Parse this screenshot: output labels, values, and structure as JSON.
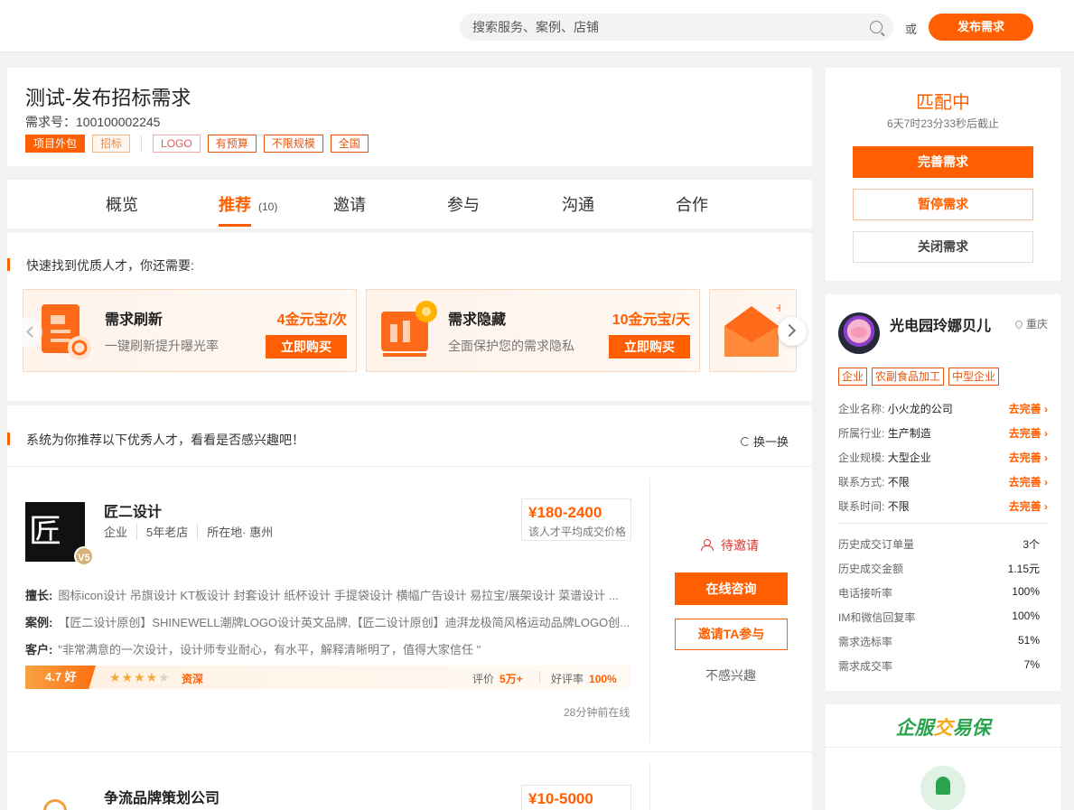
{
  "header": {
    "search_placeholder": "搜索服务、案例、店铺",
    "or_text": "或",
    "publish_label": "发布需求"
  },
  "requirement": {
    "title": "测试-发布招标需求",
    "number": "需求号：100100002245",
    "tags_primary": [
      "项目外包",
      "招标"
    ],
    "tags_secondary": [
      "LOGO",
      "有预算",
      "不限规模",
      "全国"
    ]
  },
  "tabs": [
    {
      "label": "概览"
    },
    {
      "label": "推荐",
      "count": "(10)"
    },
    {
      "label": "邀请"
    },
    {
      "label": "参与"
    },
    {
      "label": "沟通"
    },
    {
      "label": "合作"
    }
  ],
  "quick": {
    "title": "快速找到优质人才，你还需要:",
    "items": [
      {
        "name": "需求刷新",
        "desc": "一键刷新提升曝光率",
        "price": "4金元宝/次",
        "button": "立即购买"
      },
      {
        "name": "需求隐藏",
        "desc": "全面保护您的需求隐私",
        "price": "10金元宝/天",
        "button": "立即购买"
      }
    ]
  },
  "recommend": {
    "title": "系统为你推荐以下优秀人才，看看是否感兴趣吧！",
    "refresh_label": "换一换",
    "shops": [
      {
        "logo_char": "匠",
        "level": "V5",
        "name": "匠二设计",
        "meta": [
          "企业",
          "5年老店",
          "所在地· 惠州"
        ],
        "price": "¥180-2400",
        "price_label": "该人才平均成交价格",
        "skills_label": "擅长:",
        "skills": "图标icon设计 吊旗设计 KT板设计 封套设计 纸杯设计 手提袋设计 横幅广告设计 易拉宝/展架设计 菜谱设计 ...",
        "cases_label": "案例:",
        "cases": "【匠二设计原创】SHINEWELL潮牌LOGO设计英文品牌,【匠二设计原创】迪湃龙极简风格运动品牌LOGO创...",
        "client_label": "客户:",
        "client": "\"非常满意的一次设计，设计师专业耐心，有水平，解释清晰明了，值得大家信任 \"",
        "score": "4.7 好",
        "stars": 4,
        "stars_max": 5,
        "rank_label": "资深",
        "eval_label": "评价",
        "eval_value": "5万+",
        "praise_label": "好评率",
        "praise_value": "100%",
        "online": "28分钟前在线",
        "status": "待邀请",
        "consult_label": "在线咨询",
        "invite_label": "邀请TA参与",
        "not_interested_label": "不感兴趣"
      },
      {
        "name": "争流品牌策划公司",
        "price": "¥10-5000"
      }
    ]
  },
  "match": {
    "title": "匹配中",
    "deadline": "6天7时23分33秒后截止",
    "improve_label": "完善需求",
    "pause_label": "暂停需求",
    "close_label": "关闭需求"
  },
  "company": {
    "name": "光电园玲娜贝儿",
    "location": "重庆",
    "tags": [
      "企业",
      "农副食品加工",
      "中型企业"
    ],
    "fields": [
      {
        "label": "企业名称",
        "value": "小火龙的公司",
        "action": "去完善"
      },
      {
        "label": "所属行业",
        "value": "生产制造",
        "action": "去完善"
      },
      {
        "label": "企业规模",
        "value": "大型企业",
        "action": "去完善"
      },
      {
        "label": "联系方式",
        "value": "不限",
        "action": "去完善"
      },
      {
        "label": "联系时间",
        "value": "不限",
        "action": "去完善"
      }
    ],
    "stats": [
      {
        "label": "历史成交订单量",
        "value": "3个"
      },
      {
        "label": "历史成交金额",
        "value": "1.15元"
      },
      {
        "label": "电话接听率",
        "value": "100%"
      },
      {
        "label": "IM和微信回复率",
        "value": "100%"
      },
      {
        "label": "需求选标率",
        "value": "51%"
      },
      {
        "label": "需求成交率",
        "value": "7%"
      }
    ]
  },
  "trust": {
    "title_part1": "企服",
    "title_part2": "交",
    "title_part3": "易保"
  }
}
